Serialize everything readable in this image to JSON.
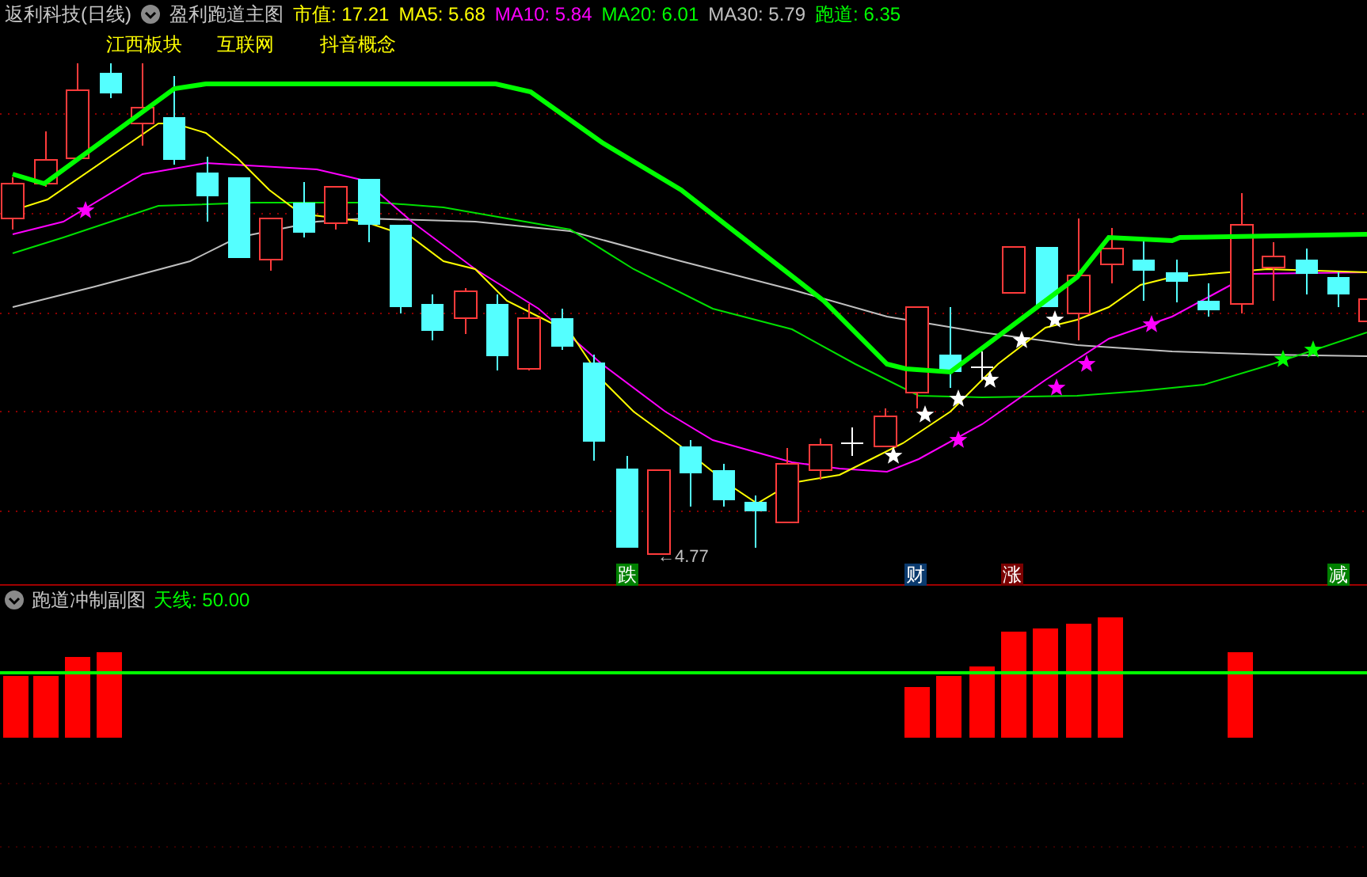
{
  "header": {
    "title": "返利科技(日线)",
    "indicator": "盈利跑道主图",
    "readings": [
      {
        "text": "市值: 17.21",
        "color": "#ffff00"
      },
      {
        "text": "MA5: 5.68",
        "color": "#ffff00"
      },
      {
        "text": "MA10: 5.84",
        "color": "#ff00ff"
      },
      {
        "text": "MA20: 6.01",
        "color": "#00ff00"
      },
      {
        "text": "MA30: 5.79",
        "color": "#c0c0c0"
      },
      {
        "text": "跑道: 6.35",
        "color": "#00ff00"
      }
    ]
  },
  "concepts": [
    "江西板块",
    "互联网",
    "抖音概念"
  ],
  "low_price_label": "←4.77",
  "signals": [
    {
      "text": "跌",
      "color": "#008000"
    },
    {
      "text": "财",
      "color": "#0a3a6e"
    },
    {
      "text": "涨",
      "color": "#7a0000"
    },
    {
      "text": "减",
      "color": "#008000"
    }
  ],
  "sub_panel": {
    "title": "跑道冲制副图",
    "reading": "天线: 50.00"
  }
}
